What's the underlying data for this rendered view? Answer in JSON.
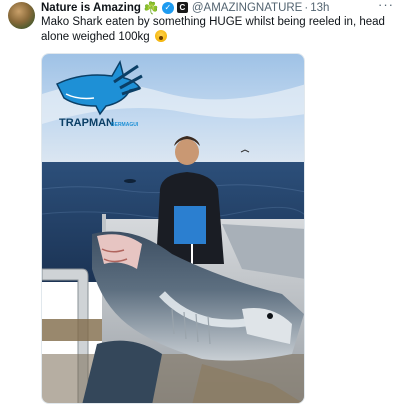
{
  "tweet": {
    "author_name": "Nature is Amazing",
    "author_emoji": "☘️",
    "affiliate_badge": "C",
    "handle": "@AMAZINGNATURE",
    "separator": "·",
    "time": "13h",
    "more_label": "···",
    "text": "Mako Shark eaten by something HUGE whilst being reeled in, head alone weighed 100kg",
    "text_emoji": "astonished-face-emoji"
  },
  "media": {
    "logo_text": "TRAPMAN",
    "logo_subtext": "BERMAGUI"
  },
  "colors": {
    "verified": "#1d9bf0",
    "text_primary": "#0f1419",
    "text_secondary": "#536471",
    "logo_blue": "#1e90d6"
  },
  "icons": [
    "clover-icon",
    "verified-badge-icon",
    "affiliate-badge-icon",
    "more-icon"
  ]
}
